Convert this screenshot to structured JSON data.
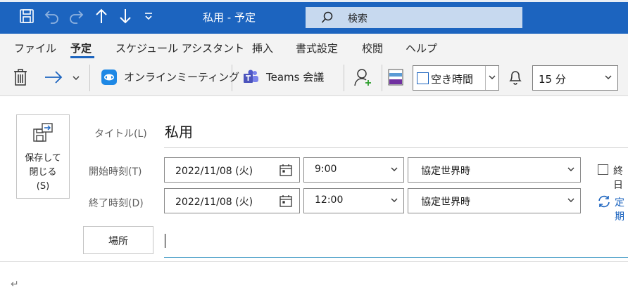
{
  "window": {
    "title": "私用 - 予定",
    "search_placeholder": "検索"
  },
  "menu": {
    "items": [
      "ファイル",
      "予定",
      "スケジュール アシスタント",
      "挿入",
      "書式設定",
      "校閲",
      "ヘルプ"
    ],
    "active": "予定"
  },
  "toolbar": {
    "online_meeting": "オンラインミーティング",
    "teams_meeting": "Teams 会議",
    "show_as": "空き時間",
    "reminder": "15 分"
  },
  "form": {
    "save_close_label": "保存して\n閉じる\n(S)",
    "title_label": "タイトル(L)",
    "title_value": "私用",
    "start_label": "開始時刻(T)",
    "start_date": "2022/11/08 (火)",
    "start_time": "9:00",
    "start_tz": "協定世界時",
    "end_label": "終了時刻(D)",
    "end_date": "2022/11/08 (火)",
    "end_time": "12:00",
    "end_tz": "協定世界時",
    "all_day_partial": "終日",
    "recurrence_partial": "定期",
    "location_button": "場所",
    "location_value": "",
    "body_paragraph_mark": "↵"
  },
  "colors": {
    "titlebar": "#1c64bf",
    "search_box": "#c7d9ef",
    "ribbon": "#f3f3f3",
    "accent_underline": "#2d8fbf"
  }
}
